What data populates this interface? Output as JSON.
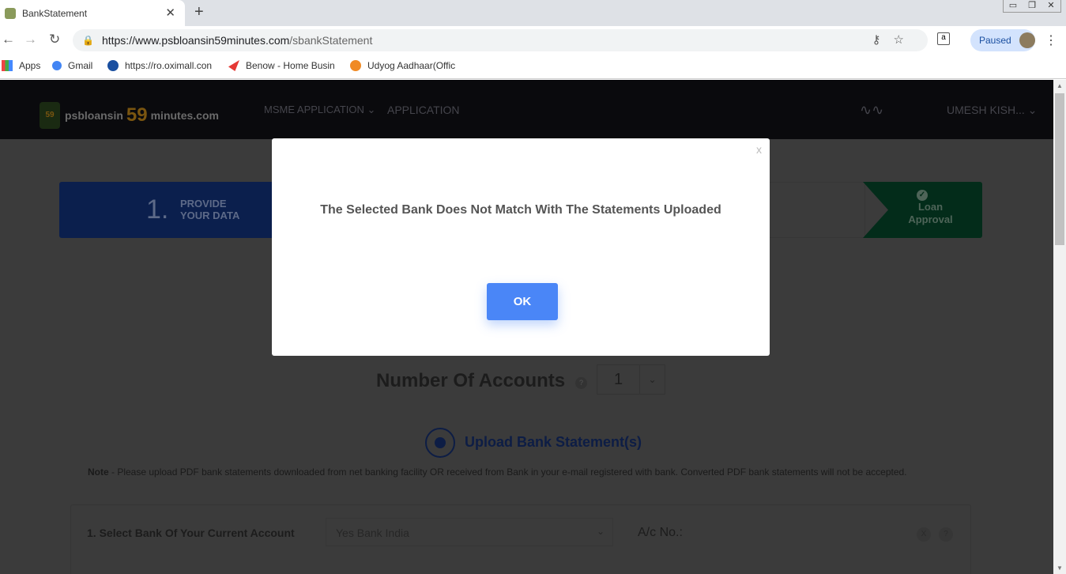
{
  "browser": {
    "tab_title": "BankStatement",
    "tab_close": "✕",
    "new_tab": "+",
    "url_domain": "https://www.psbloansin59minutes.com",
    "url_path": "/sbankStatement",
    "profile_status": "Paused",
    "bookmarks": [
      "Apps",
      "Gmail",
      "https://ro.oximall.con",
      "Benow - Home Busin",
      "Udyog Aadhaar(Offic"
    ]
  },
  "site": {
    "logo_pre": "psbloansin",
    "logo_num": "59",
    "logo_post": "minutes.com",
    "nav": [
      "MSME APPLICATION",
      "APPLICATION"
    ],
    "user": "UMESH KISH...",
    "steps": [
      {
        "num": "1.",
        "label_line1": "PROVIDE",
        "label_line2": "YOUR DATA"
      },
      {
        "label_line1": "Loan",
        "label_line2": "Approval"
      }
    ],
    "accounts_label": "Number Of Accounts",
    "accounts_help": "?",
    "accounts_value": "1",
    "upload_label": "Upload Bank Statement(s)",
    "note_bold": "Note",
    "note_text": " - Please upload PDF bank statements downloaded from net banking facility OR received from Bank in your e-mail registered with bank. Converted PDF bank statements will not be accepted.",
    "select_bank_label": "1. Select Bank Of Your Current Account",
    "selected_bank": "Yes Bank India",
    "acno_label": "A/c No.:",
    "remove": "X",
    "help": "?"
  },
  "modal": {
    "close": "x",
    "message": "The Selected Bank Does Not Match With The Statements Uploaded",
    "ok_label": "OK"
  },
  "colors": {
    "primary": "#4a86f7",
    "step1": "#0d3ea8",
    "step4": "#0b8a4a"
  }
}
